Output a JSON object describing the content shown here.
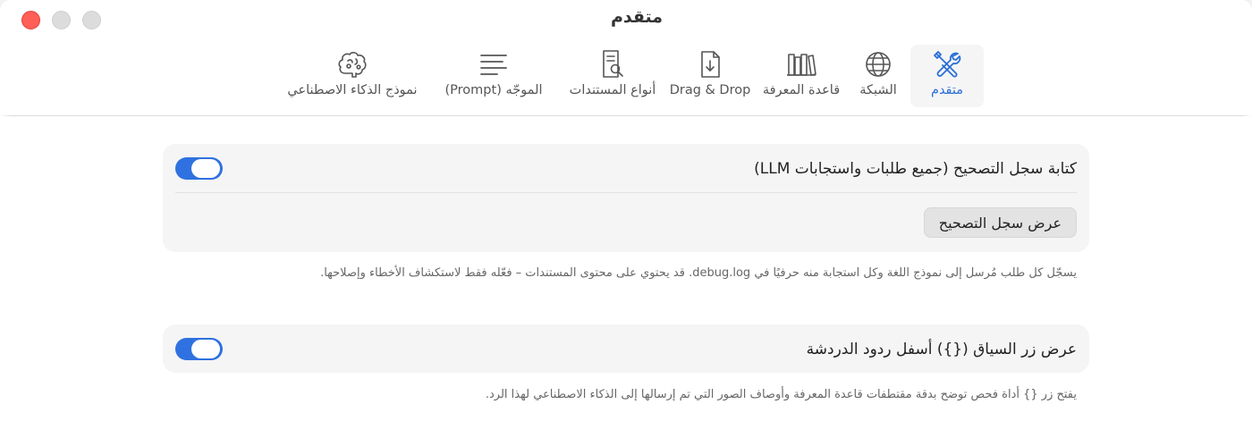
{
  "window": {
    "title": "متقدم"
  },
  "toolbar": {
    "tabs": [
      {
        "label": "متقدم",
        "icon": "tools-icon",
        "active": true
      },
      {
        "label": "الشبكة",
        "icon": "globe-icon",
        "active": false
      },
      {
        "label": "قاعدة المعرفة",
        "icon": "books-icon",
        "active": false
      },
      {
        "label": "Drag & Drop",
        "icon": "download-doc-icon",
        "active": false
      },
      {
        "label": "أنواع المستندات",
        "icon": "doc-search-icon",
        "active": false
      },
      {
        "label": "الموجّه (Prompt)",
        "icon": "lines-icon",
        "active": false
      },
      {
        "label": "نموذج الذكاء الاصطناعي",
        "icon": "brain-icon",
        "active": false
      }
    ]
  },
  "settings": {
    "debug_log": {
      "label": "كتابة سجل التصحيح (جميع طلبات واستجابات LLM)",
      "enabled": true,
      "button_label": "عرض سجل التصحيح",
      "hint": "يسجّل كل طلب مُرسل إلى نموذج اللغة وكل استجابة منه حرفيًا في debug.log. قد يحتوي على محتوى المستندات – فعّله فقط لاستكشاف الأخطاء وإصلاحها."
    },
    "context_button": {
      "label": "عرض زر السياق ({}) أسفل ردود الدردشة",
      "enabled": true,
      "hint": "يفتح زر {} أداة فحص توضح بدقة مقتطفات قاعدة المعرفة وأوصاف الصور التي تم إرسالها إلى الذكاء الاصطناعي لهذا الرد."
    }
  },
  "colors": {
    "accent": "#2f71e0",
    "close": "#ff5f57"
  }
}
